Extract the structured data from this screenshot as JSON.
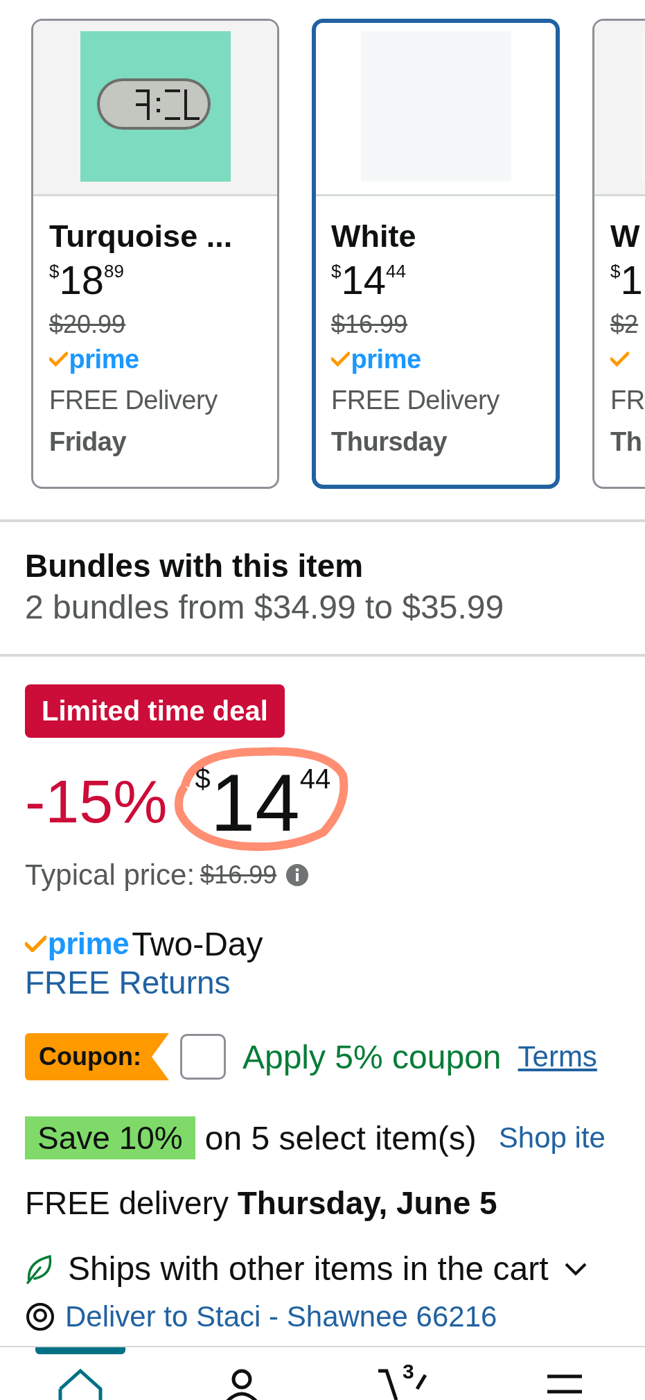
{
  "variant_cards": [
    {
      "kind": "picture",
      "name": "Turquoise ...",
      "currency": "$",
      "price_whole": "18",
      "price_fraction": "89",
      "list_price": "$20.99",
      "prime": "prime",
      "delivery": "FREE Delivery",
      "delivery_day": "Friday",
      "selected": false
    },
    {
      "kind": "placeholder",
      "name": "White",
      "currency": "$",
      "price_whole": "14",
      "price_fraction": "44",
      "list_price": "$16.99",
      "prime": "prime",
      "delivery": "FREE Delivery",
      "delivery_day": "Thursday",
      "selected": true
    },
    {
      "kind": "placeholder",
      "name": "W",
      "currency": "$",
      "price_whole": "1",
      "list_price": "$2",
      "delivery": "FR",
      "delivery_day": "Th",
      "selected": false
    }
  ],
  "bundles": {
    "title": "Bundles with this item",
    "summary": "2 bundles from $34.99 to $35.99"
  },
  "deal": {
    "badge": "Limited time deal",
    "discount": "-15%",
    "currency": "$",
    "price_whole": "14",
    "price_fraction": "44",
    "typical_label": "Typical price:",
    "typical_price": "$16.99"
  },
  "prime_shipping": {
    "prime": "prime",
    "speed": "Two-Day",
    "returns_link": "FREE Returns"
  },
  "coupon": {
    "badge": "Coupon:",
    "checked": false,
    "label": "Apply 5% coupon",
    "terms_link": "Terms"
  },
  "promotion": {
    "badge": "Save 10%",
    "text": "on 5 select item(s)",
    "link": "Shop ite"
  },
  "delivery": {
    "text": "FREE delivery **Thursday, June 5**"
  },
  "ships_with": {
    "text": "Ships with other items in the cart",
    "expanded": false
  },
  "deliver_to": {
    "text": "Deliver to Staci - Shawnee 66216"
  },
  "bottom_nav": [
    {
      "kind": "home",
      "selected": true
    },
    {
      "kind": "account",
      "selected": false
    },
    {
      "kind": "cart",
      "count": "3",
      "selected": false
    },
    {
      "kind": "menu",
      "selected": false
    }
  ]
}
